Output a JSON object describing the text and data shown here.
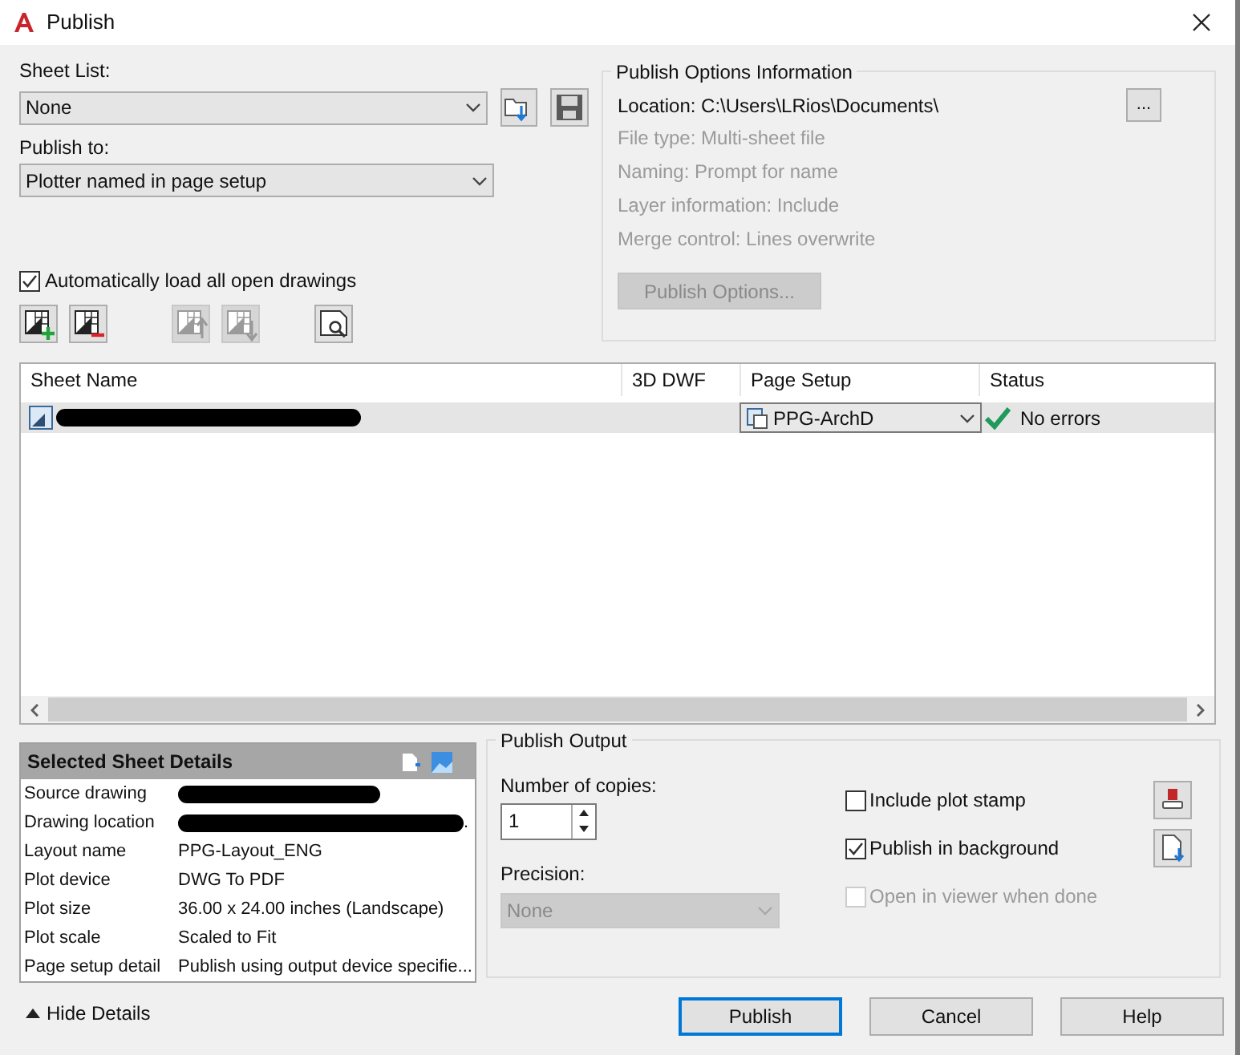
{
  "window": {
    "title": "Publish"
  },
  "sheet_list": {
    "label": "Sheet List:",
    "value": "None"
  },
  "publish_to": {
    "label": "Publish to:",
    "value": "Plotter named in page setup"
  },
  "auto_load": {
    "label": "Automatically load all open drawings",
    "checked": true
  },
  "sheet_tools": [
    {
      "kind": "add",
      "disabled": false
    },
    {
      "kind": "remove",
      "disabled": false
    },
    {
      "kind": "up",
      "disabled": true
    },
    {
      "kind": "down",
      "disabled": true
    },
    {
      "kind": "preview",
      "disabled": false
    }
  ],
  "publish_options_info": {
    "title": "Publish Options Information",
    "location": "Location: C:\\Users\\LRios\\Documents\\",
    "browse_button": "...",
    "lines": [
      "File type: Multi-sheet file",
      "Naming: Prompt for name",
      "Layer information: Include",
      "Merge control: Lines overwrite"
    ],
    "options_button": {
      "label": "Publish Options...",
      "disabled": true
    }
  },
  "table": {
    "columns": [
      "Sheet Name",
      "3D DWF",
      "Page Setup",
      "Status"
    ],
    "rows": [
      {
        "page_setup": "PPG-ArchD",
        "status": "No errors",
        "selected": true
      }
    ]
  },
  "details": {
    "title": "Selected Sheet Details",
    "rows": [
      {
        "label": "Source drawing",
        "redacted": true
      },
      {
        "label": "Drawing location",
        "redacted": true,
        "value": "."
      },
      {
        "label": "Layout name",
        "value": "PPG-Layout_ENG"
      },
      {
        "label": "Plot device",
        "value": "DWG To PDF"
      },
      {
        "label": "Plot size",
        "value": "36.00 x 24.00 inches (Landscape)"
      },
      {
        "label": "Plot scale",
        "value": "Scaled to Fit"
      },
      {
        "label": "Page setup detail",
        "value": "Publish using output device specifie..."
      }
    ]
  },
  "hide_details": "Hide Details",
  "publish_output": {
    "title": "Publish Output",
    "copies_label": "Number of copies:",
    "copies": "1",
    "precision_label": "Precision:",
    "precision": {
      "value": "None",
      "disabled": true
    },
    "options": [
      {
        "label": "Include plot stamp",
        "checked": false,
        "disabled": false
      },
      {
        "label": "Publish in background",
        "checked": true,
        "disabled": false
      },
      {
        "label": "Open in viewer when done",
        "checked": false,
        "disabled": true
      }
    ]
  },
  "buttons": [
    {
      "label": "Publish",
      "default": true
    },
    {
      "label": "Cancel",
      "default": false
    },
    {
      "label": "Help",
      "default": false
    }
  ]
}
